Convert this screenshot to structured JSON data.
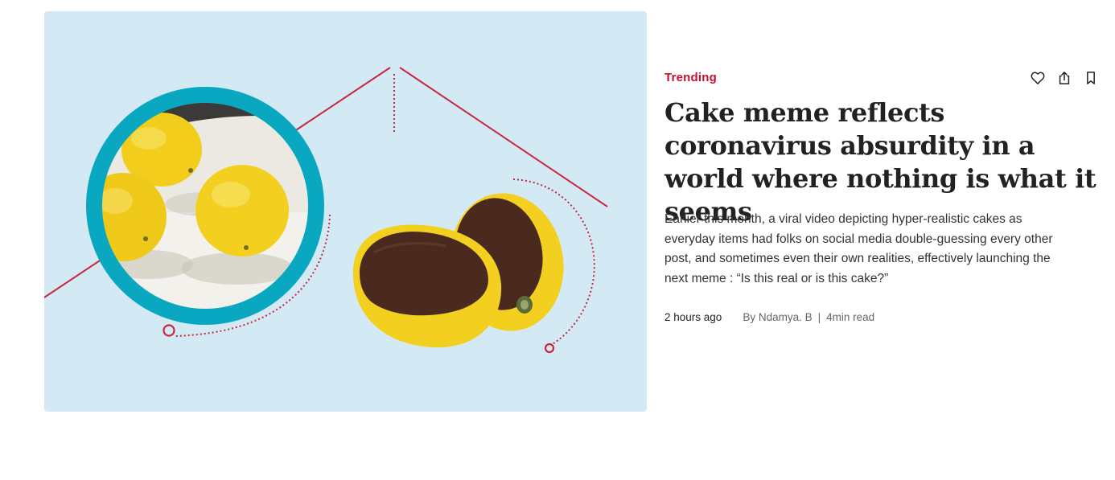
{
  "article": {
    "category": "Trending",
    "title": "Cake meme reflects coronavirus absurdity in a world where nothing is what it seems",
    "excerpt": "Earlier this month, a viral video depicting hyper-realistic cakes as everyday items had folks on social media double-guessing every other post, and sometimes even their own realities, effectively launching the next meme : “Is this real or is this cake?”",
    "time_ago": "2 hours ago",
    "author": "By Ndamya. B",
    "separator": "|",
    "read_time": "4min read"
  },
  "actions": {
    "like_icon": "heart-icon",
    "share_icon": "share-icon",
    "bookmark_icon": "bookmark-icon"
  },
  "colors": {
    "accent": "#c8102e",
    "hero_background": "#d3e9f3",
    "ring": "#0aa7c1",
    "lemon": "#f3d222",
    "cake": "#4a2a1e"
  }
}
